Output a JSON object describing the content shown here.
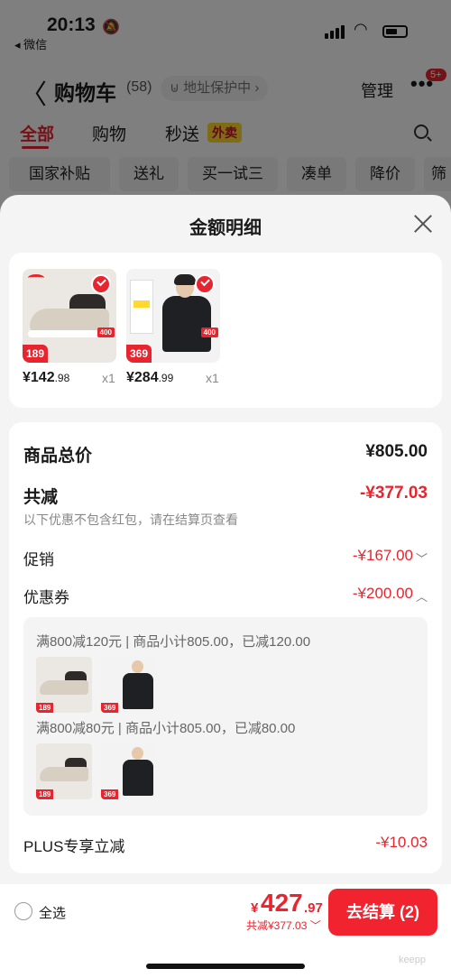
{
  "status": {
    "time": "20:13",
    "back_app": "◂ 微信"
  },
  "navbar": {
    "back": "〈",
    "title": "购物车",
    "count": "(58)",
    "protect": "⊍ 地址保护中 ›",
    "manage": "管理",
    "more": "•••",
    "badge": "5+"
  },
  "tabs": {
    "all": "全部",
    "shop": "购物",
    "flash": "秒送",
    "waimai": "外卖"
  },
  "chips": [
    "国家补贴",
    "送礼",
    "买一试三",
    "凑单",
    "降价",
    "筛"
  ],
  "sheet": {
    "title": "金额明细"
  },
  "products": [
    {
      "price_main": "¥142",
      "price_dec": ".98",
      "qty": "x1",
      "tag": "189",
      "tag2": "400"
    },
    {
      "price_main": "¥284",
      "price_dec": ".99",
      "qty": "x1",
      "tag": "369",
      "tag2": "400"
    }
  ],
  "summary": {
    "subtotal_label": "商品总价",
    "subtotal_value": "¥805.00",
    "reduce_label": "共减",
    "reduce_value": "-¥377.03",
    "note": "以下优惠不包含红包，请在结算页查看",
    "promo_label": "促销",
    "promo_value": "-¥167.00",
    "coupon_label": "优惠券",
    "coupon_value": "-¥200.00",
    "coupon_lines": [
      "满800减120元 | 商品小计805.00，已减120.00",
      "满800减80元 | 商品小计805.00，已减80.00"
    ],
    "plus_label": "PLUS专享立减",
    "plus_value": "-¥10.03"
  },
  "bottom": {
    "select_all": "全选",
    "currency": "¥",
    "total_int": "427",
    "total_dec": ".97",
    "total_sub": "共减¥377.03",
    "checkout": "去结算 (2)",
    "watermark": "keepp"
  },
  "colors": {
    "accent": "#e8242e",
    "sheet_bg": "#f4f4f4"
  }
}
